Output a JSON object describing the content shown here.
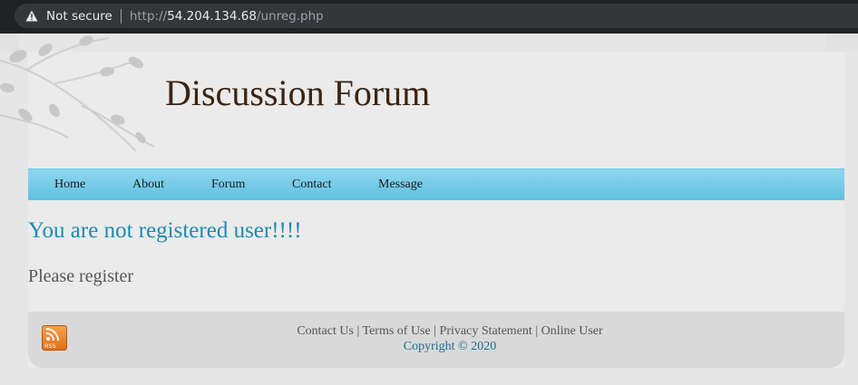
{
  "browser": {
    "security_label": "Not secure",
    "url_scheme": "http://",
    "url_host": "54.204.134.68",
    "url_path": "/unreg.php"
  },
  "header": {
    "title": "Discussion Forum"
  },
  "nav": {
    "items": [
      {
        "label": "Home"
      },
      {
        "label": "About"
      },
      {
        "label": "Forum"
      },
      {
        "label": "Contact"
      },
      {
        "label": "Message"
      }
    ]
  },
  "main": {
    "headline": "You are not registered user!!!!",
    "subtext": "Please register"
  },
  "footer": {
    "rss_label": "RSS",
    "links": [
      {
        "label": "Contact Us"
      },
      {
        "label": "Terms of Use"
      },
      {
        "label": "Privacy Statement"
      },
      {
        "label": "Online User"
      }
    ],
    "separator": " | ",
    "copyright": "Copyright © 2020"
  },
  "colors": {
    "title": "#3b2412",
    "nav_bar": "#7ccce8",
    "headline": "#1a8cb0",
    "copyright": "#1a6d8c"
  }
}
